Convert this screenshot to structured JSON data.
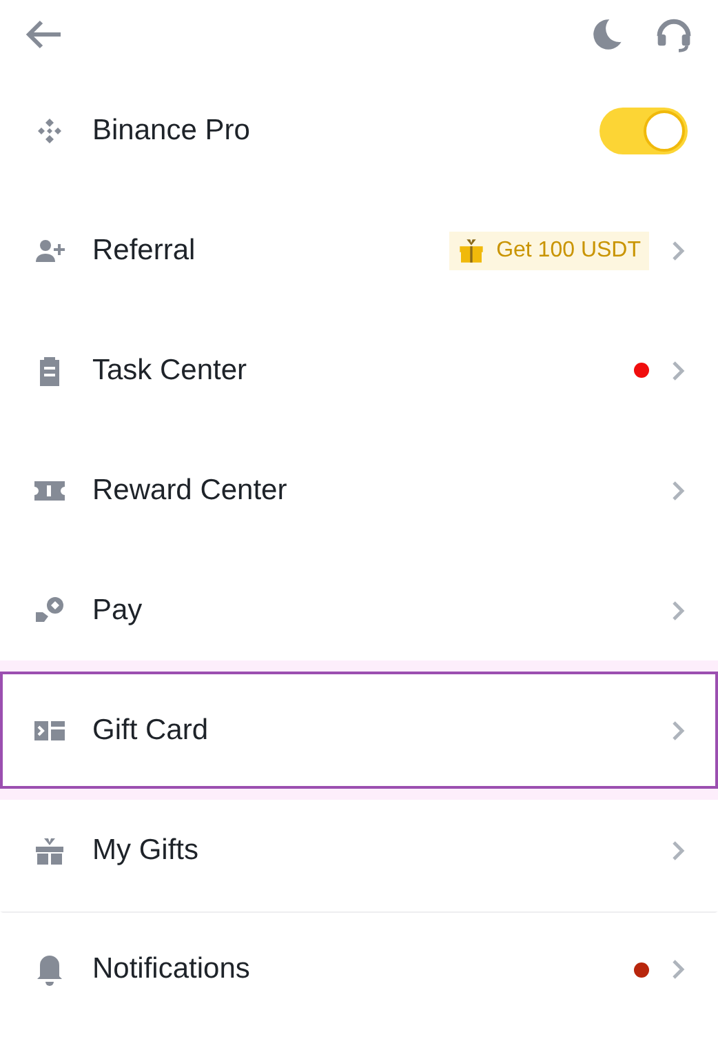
{
  "items": [
    {
      "kind": "toggle",
      "label": "Binance Pro",
      "on": true,
      "selected": false
    },
    {
      "kind": "badge",
      "label": "Referral",
      "badge": "Get 100 USDT",
      "selected": false
    },
    {
      "kind": "dot",
      "label": "Task Center",
      "color": "#f00d0d",
      "selected": false
    },
    {
      "kind": "plain",
      "label": "Reward Center",
      "selected": false
    },
    {
      "kind": "plain",
      "label": "Pay",
      "selected": false
    },
    {
      "kind": "plain",
      "label": "Gift Card",
      "selected": true
    },
    {
      "kind": "plain",
      "label": "My Gifts",
      "selected": false
    },
    {
      "kind": "dot",
      "label": "Notifications",
      "color": "#b8260c",
      "selected": false
    }
  ]
}
